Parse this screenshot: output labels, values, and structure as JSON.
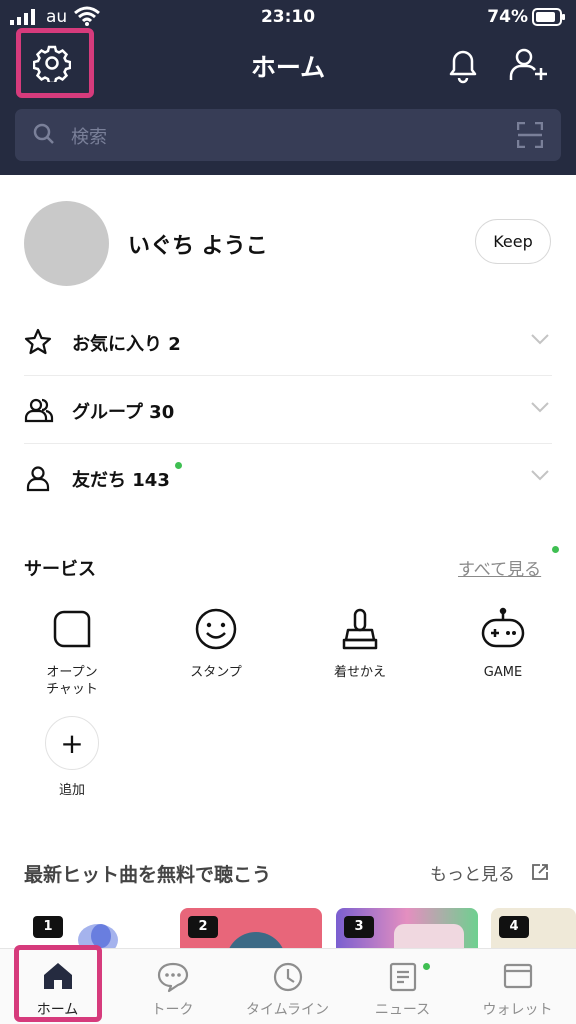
{
  "status_bar": {
    "carrier": "au",
    "time": "23:10",
    "battery": "74%"
  },
  "header": {
    "title": "ホーム",
    "search_placeholder": "検索"
  },
  "profile": {
    "name": "いぐち ようこ",
    "keep_label": "Keep"
  },
  "friend_rows": [
    {
      "label": "お気に入り 2",
      "icon": "star-icon"
    },
    {
      "label": "グループ 30",
      "icon": "group-icon"
    },
    {
      "label": "友だち 143",
      "icon": "person-icon"
    }
  ],
  "services": {
    "title": "サービス",
    "see_all": "すべて見る",
    "items": [
      {
        "label": "オープン\nチャット",
        "icon": "open-chat-icon"
      },
      {
        "label": "スタンプ",
        "icon": "smile-icon"
      },
      {
        "label": "着せかえ",
        "icon": "brush-icon"
      },
      {
        "label": "GAME",
        "icon": "gamepad-icon"
      },
      {
        "label": "追加",
        "icon": "plus-icon"
      }
    ]
  },
  "music": {
    "title": "最新ヒット曲を無料で聴こう",
    "more": "もっと見る",
    "cards": [
      {
        "rank": "1",
        "color": "#ffffff"
      },
      {
        "rank": "2",
        "color": "#e8667a"
      },
      {
        "rank": "3",
        "color": "#7a5fd0"
      },
      {
        "rank": "4",
        "color": "#efe9d8"
      }
    ]
  },
  "tabs": [
    {
      "label": "ホーム",
      "icon": "home-icon",
      "active": true
    },
    {
      "label": "トーク",
      "icon": "chat-bubble-icon",
      "active": false
    },
    {
      "label": "タイムライン",
      "icon": "clock-icon",
      "active": false
    },
    {
      "label": "ニュース",
      "icon": "news-icon",
      "active": false
    },
    {
      "label": "ウォレット",
      "icon": "wallet-icon",
      "active": false
    }
  ],
  "colors": {
    "header_bg": "#252b40",
    "highlight": "#d63b7c",
    "badge_green": "#3fbf52"
  }
}
